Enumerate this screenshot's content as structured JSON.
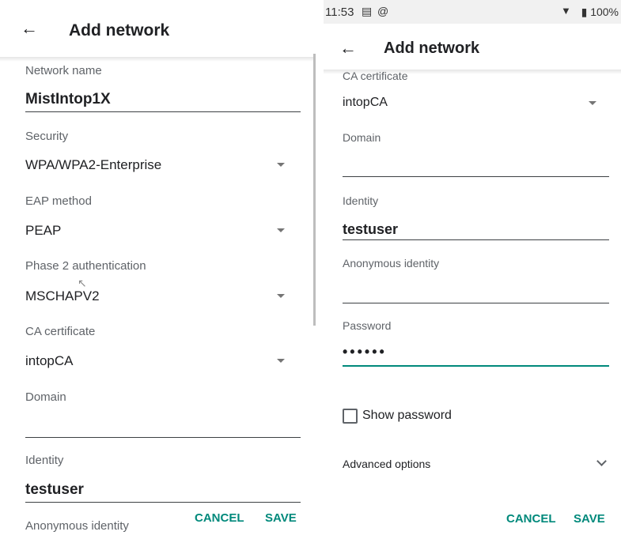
{
  "left": {
    "title": "Add network",
    "network_name": {
      "label": "Network name",
      "value": "MistIntop1X"
    },
    "security": {
      "label": "Security",
      "value": "WPA/WPA2-Enterprise"
    },
    "eap_method": {
      "label": "EAP method",
      "value": "PEAP"
    },
    "phase2": {
      "label": "Phase 2 authentication",
      "value": "MSCHAPV2"
    },
    "ca_certificate": {
      "label": "CA certificate",
      "value": "intopCA"
    },
    "domain": {
      "label": "Domain",
      "value": ""
    },
    "identity": {
      "label": "Identity",
      "value": "testuser"
    },
    "anonymous_identity": {
      "label": "Anonymous identity"
    },
    "buttons": {
      "cancel": "CANCEL",
      "save": "SAVE"
    }
  },
  "right": {
    "status_bar": {
      "time": "11:53",
      "battery": "100%"
    },
    "title": "Add network",
    "ca_certificate": {
      "label": "CA certificate",
      "value": "intopCA"
    },
    "domain": {
      "label": "Domain",
      "value": ""
    },
    "identity": {
      "label": "Identity",
      "value": "testuser"
    },
    "anonymous_identity": {
      "label": "Anonymous identity",
      "value": ""
    },
    "password": {
      "label": "Password",
      "value": "••••••"
    },
    "show_password": {
      "label": "Show password",
      "checked": false
    },
    "advanced_options": {
      "label": "Advanced options"
    },
    "buttons": {
      "cancel": "CANCEL",
      "save": "SAVE"
    }
  },
  "colors": {
    "accent": "#00897b",
    "text": "#202124",
    "label": "#5f6368",
    "status_bar": "#f1f1f1"
  }
}
